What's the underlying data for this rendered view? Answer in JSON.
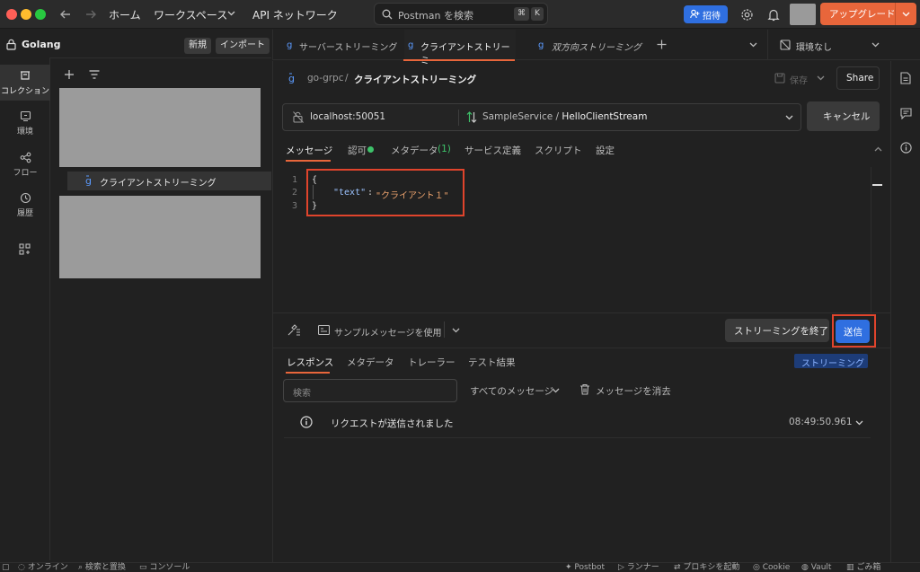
{
  "topbar": {
    "home": "ホーム",
    "workspaces": "ワークスペース",
    "api_network": "API ネットワーク",
    "search_placeholder": "Postman を検索",
    "kbd_cmd": "⌘",
    "kbd_k": "K",
    "invite": "招待",
    "upgrade": "アップグレード"
  },
  "workspace": {
    "name": "Golang",
    "new_button": "新規",
    "import_button": "インポート"
  },
  "rail": [
    {
      "label": "コレクション",
      "icon": "collection-icon"
    },
    {
      "label": "環境",
      "icon": "environment-icon"
    },
    {
      "label": "フロー",
      "icon": "flows-icon"
    },
    {
      "label": "履歴",
      "icon": "history-icon"
    },
    {
      "label": "",
      "icon": "add-apps-icon"
    }
  ],
  "sidebar": {
    "tree_item": "クライアントストリーミング"
  },
  "tabs": [
    {
      "label": "サーバーストリーミング"
    },
    {
      "label": "クライアントストリーミ"
    },
    {
      "label": "双方向ストリーミング"
    }
  ],
  "environment": "環境なし",
  "breadcrumb": {
    "collection": "go-grpc",
    "separator": "/",
    "request": "クライアントストリーミング"
  },
  "header_actions": {
    "save": "保存",
    "share": "Share"
  },
  "request": {
    "url": "localhost:50051",
    "service": "SampleService",
    "method_sep": "/",
    "method": "HelloClientStream",
    "cancel": "キャンセル"
  },
  "subtabs": {
    "message": "メッセージ",
    "auth": "認可",
    "metadata": "メタデータ",
    "metadata_count": "(1)",
    "service_def": "サービス定義",
    "script": "スクリプト",
    "settings": "設定"
  },
  "editor": {
    "line_numbers": [
      "1",
      "2",
      "3"
    ],
    "open_brace": "{",
    "key": "\"text\"",
    "colon": ":",
    "value": "\"クライアント１\"",
    "close_brace": "}"
  },
  "editor_footer": {
    "use_sample": "サンプルメッセージを使用",
    "end_streaming": "ストリーミングを終了",
    "send": "送信"
  },
  "response": {
    "tabs": [
      "レスポンス",
      "メタデータ",
      "トレーラー",
      "テスト結果"
    ],
    "badge": "ストリーミング",
    "search_placeholder": "検索",
    "filter": "すべてのメッセージ",
    "clear": "メッセージを消去",
    "event_text": "リクエストが送信されました",
    "event_time": "08:49:50.961"
  },
  "statusbar": {
    "online": "オンライン",
    "find_replace": "検索と置換",
    "console": "コンソール",
    "postbot": "Postbot",
    "runner": "ランナー",
    "proxy": "プロキシを起動",
    "cookie": "Cookie",
    "vault": "Vault",
    "trash": "ごみ箱"
  },
  "colors": {
    "accent": "#e8663b",
    "primary_button": "#2f6fe0",
    "highlight_box": "#e0442c",
    "auth_dot": "#3ec26a"
  }
}
